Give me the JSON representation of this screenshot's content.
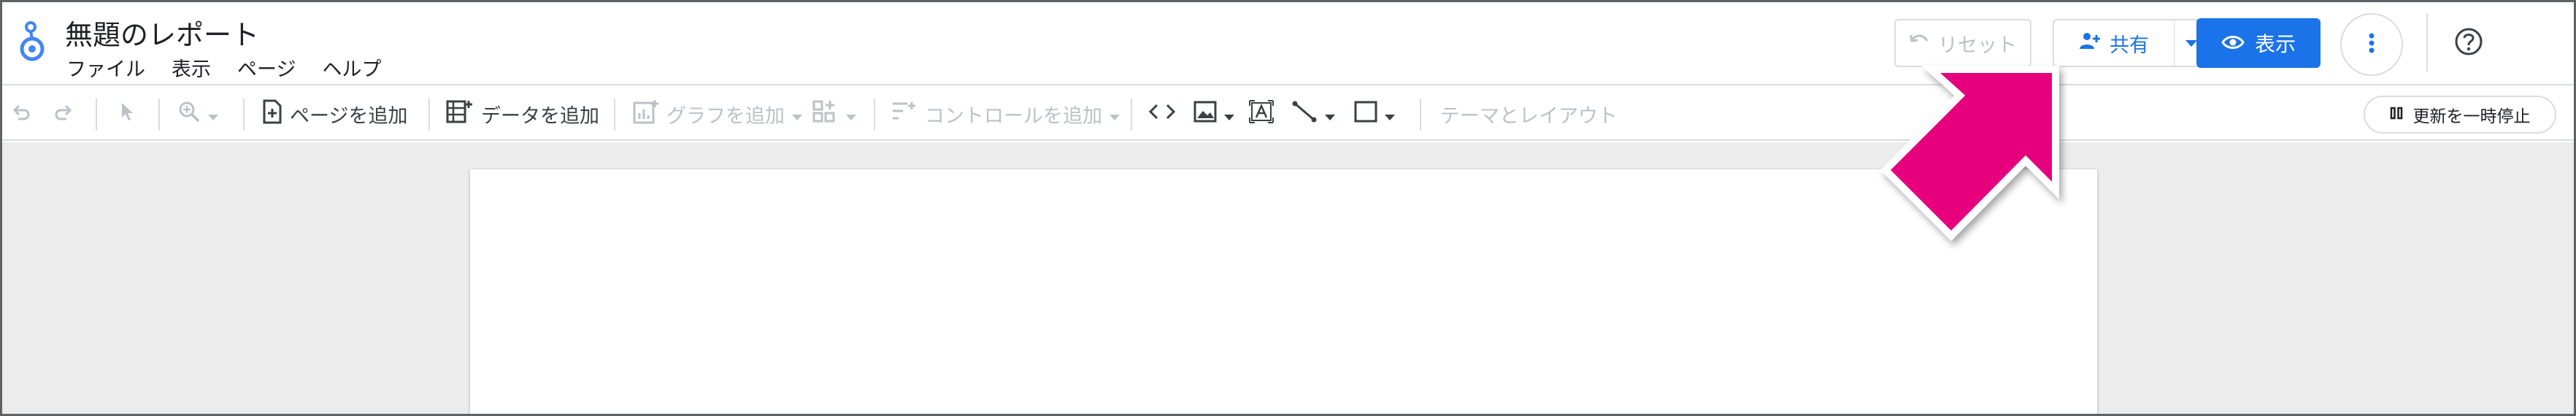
{
  "app": {
    "title": "無題のレポート",
    "menu": [
      "ファイル",
      "表示",
      "ページ",
      "ヘルプ"
    ]
  },
  "header_buttons": {
    "reset": "リセット",
    "share": "共有",
    "view": "表示"
  },
  "toolbar": {
    "add_page": "ページを追加",
    "add_data": "データを追加",
    "add_chart": "グラフを追加",
    "add_control": "コントロールを追加",
    "theme_layout": "テーマとレイアウト",
    "pause_update": "更新を一時停止"
  },
  "colors": {
    "accent": "#1a73e8",
    "callout": "#e6007e",
    "disabled": "#bdc1c6",
    "canvas_bg": "#ececec"
  },
  "icons": {
    "logo": "looker-studio-logo-icon",
    "reset": "undo-icon",
    "share": "person-add-icon",
    "view": "eye-icon",
    "more": "more-vert-icon",
    "help": "help-icon",
    "callout": "pointer-arrow-icon"
  }
}
